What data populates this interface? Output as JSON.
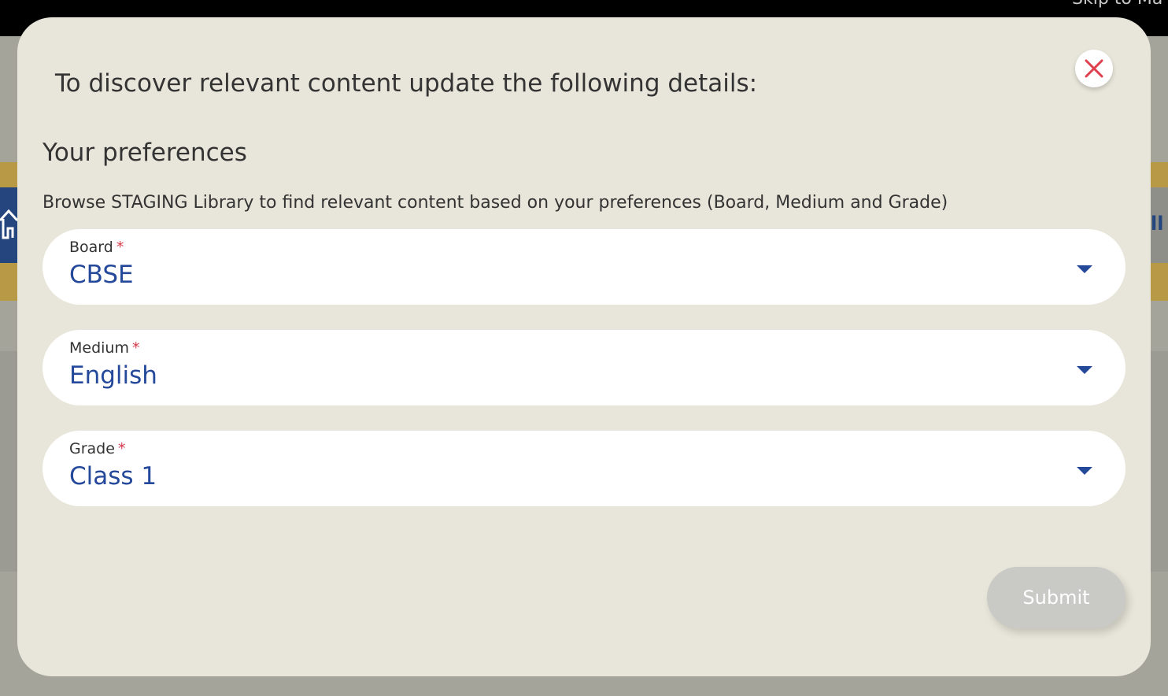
{
  "background": {
    "skip_link": "Skip to Ma",
    "right_edge_text": "ll"
  },
  "modal": {
    "header": "To discover relevant content update the following details:",
    "close_icon": "close-icon",
    "section_title": "Your preferences",
    "description": "Browse STAGING Library to find relevant content based on your preferences (Board, Medium and Grade)",
    "required_mark": "*",
    "fields": [
      {
        "label": "Board",
        "value": "CBSE"
      },
      {
        "label": "Medium",
        "value": "English"
      },
      {
        "label": "Grade",
        "value": "Class 1"
      }
    ],
    "submit_label": "Submit",
    "submit_enabled": false
  },
  "colors": {
    "modal_bg": "#e8e6da",
    "value_blue": "#24489a",
    "required_red": "#d6394b",
    "close_red": "#e0404e",
    "submit_disabled": "#c9c9c5"
  }
}
